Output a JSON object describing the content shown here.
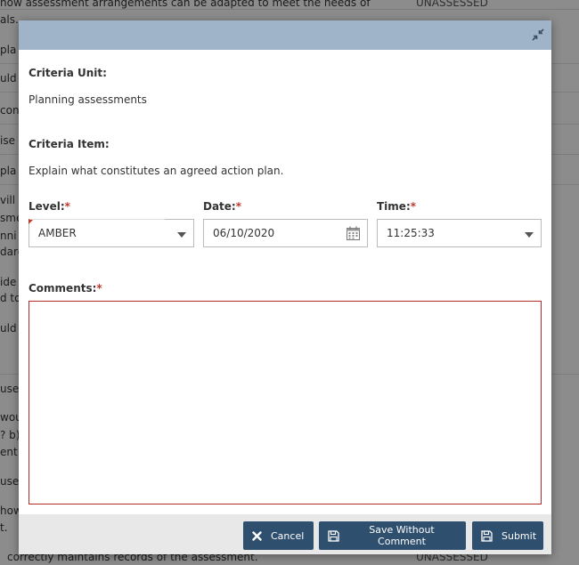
{
  "background": {
    "rows": [
      {
        "text": "how assessment arrangements can be adapted to meet the needs of",
        "status": "UNASSESSED"
      },
      {
        "text": "als.",
        "status": ""
      },
      {
        "text": "pla",
        "status": ""
      },
      {
        "text": "uld",
        "status": ""
      },
      {
        "text": "con",
        "status": ""
      },
      {
        "text": "ise",
        "status": ""
      },
      {
        "text": "pla",
        "status": ""
      },
      {
        "text": "vill",
        "status": ""
      },
      {
        "text": "sme",
        "status": ""
      },
      {
        "text": "nni",
        "status": ""
      },
      {
        "text": "dard",
        "status": ""
      },
      {
        "text": "ide",
        "status": ""
      },
      {
        "text": "d to",
        "status": ""
      },
      {
        "text": "uld",
        "status": ""
      },
      {
        "text": "use",
        "status": ""
      },
      {
        "text": "wou",
        "status": ""
      },
      {
        "text": "? b)",
        "status": ""
      },
      {
        "text": "ent",
        "status": ""
      },
      {
        "text": "use",
        "status": ""
      },
      {
        "text": "how",
        "status": ""
      },
      {
        "text": "t.",
        "status": ""
      },
      {
        "text": "correctly maintains records of the assessment.",
        "status": "UNASSESSED"
      }
    ]
  },
  "dialog": {
    "criteria_unit_label": "Criteria Unit:",
    "criteria_unit_value": "Planning assessments",
    "criteria_item_label": "Criteria Item:",
    "criteria_item_value": "Explain what constitutes an agreed action plan.",
    "level_label": "Level:",
    "level_value": "AMBER",
    "date_label": "Date:",
    "date_value": "06/10/2020",
    "time_label": "Time:",
    "time_value": "11:25:33",
    "comments_label": "Comments:",
    "required_mark": "*",
    "comments_value": ""
  },
  "footer": {
    "cancel_label": "Cancel",
    "save_without_comment_label": "Save Without Comment",
    "submit_label": "Submit"
  },
  "colors": {
    "header": "#9fb3c9",
    "button": "#2f4f6e",
    "required": "#c0392b"
  }
}
